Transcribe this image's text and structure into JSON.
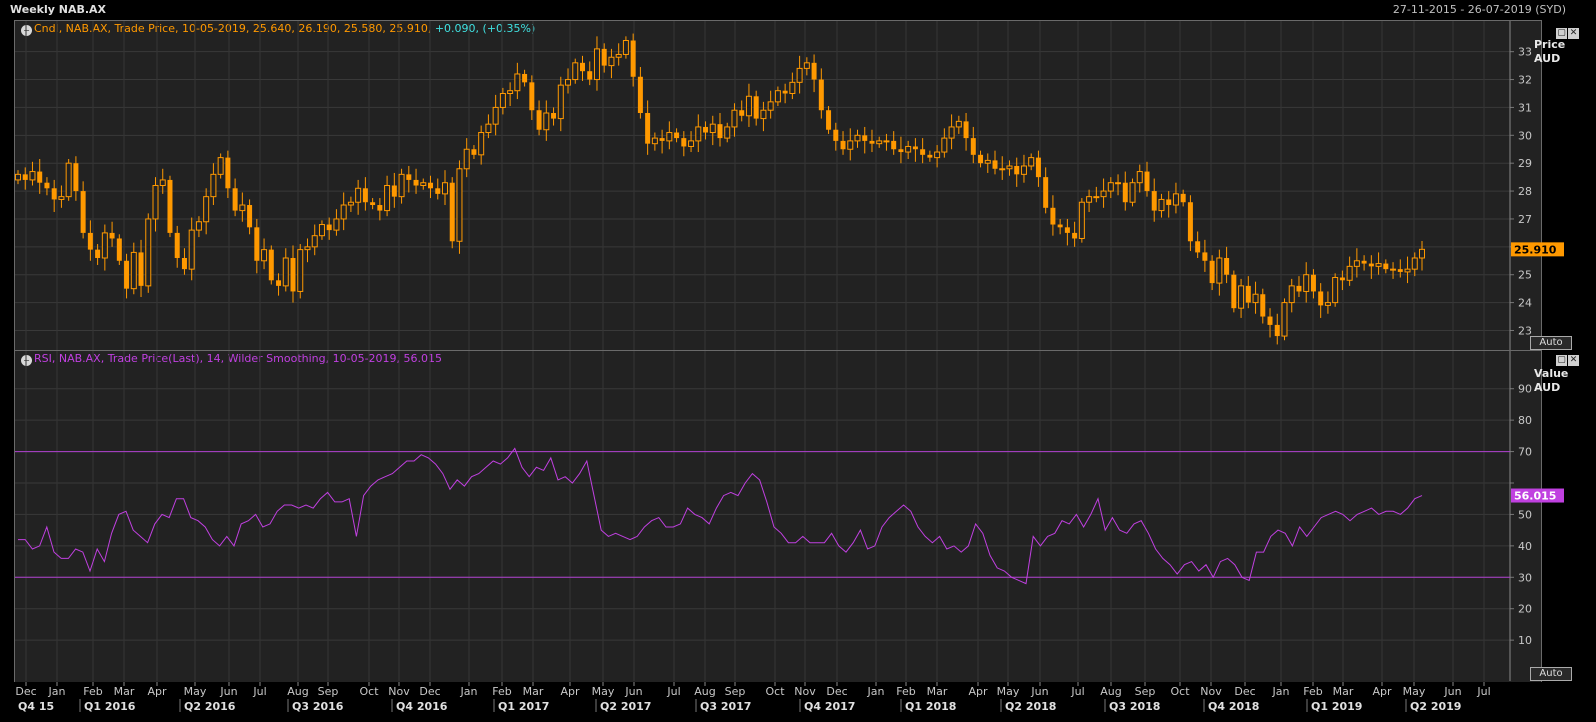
{
  "header": {
    "title": "Weekly NAB.AX",
    "date_range": "27-11-2015 - 26-07-2019 (SYD)"
  },
  "price_panel": {
    "legend_label": "Cndl, NAB.AX, Trade Price, 10-05-2019, 25.640, 26.190, 25.580, 25.910, ",
    "legend_change": "+0.090, (+0.35%)",
    "axis_title": "Price",
    "axis_unit": "AUD",
    "last_value": "25.910",
    "auto_label": "Auto"
  },
  "rsi_panel": {
    "legend_label": "RSI, NAB.AX, Trade Price(Last),  14, Wilder Smoothing,  10-05-2019, 56.015",
    "axis_title": "Value",
    "axis_unit": "AUD",
    "last_value": "56.015",
    "auto_label": "Auto"
  },
  "window_buttons": {
    "restore": "▢",
    "close": "✕"
  },
  "colors": {
    "up": "#ff9900",
    "down": "#ff9900",
    "rsi": "#c040e0",
    "band": "#b040d0",
    "price_badge": "#ff9900",
    "rsi_badge": "#c040e0",
    "change": "#40e0e0"
  },
  "chart_data": [
    {
      "type": "candlestick",
      "title": "Weekly NAB.AX",
      "ylabel": "Price AUD",
      "ylim": [
        22.3,
        34.1
      ],
      "yticks": [
        23,
        24,
        25,
        26,
        27,
        28,
        29,
        30,
        31,
        32,
        33
      ],
      "ytick_labels": [
        "23",
        "24",
        "25",
        "27",
        "28",
        "29",
        "30",
        "31",
        "32",
        "33"
      ],
      "ytick_label_values": [
        23,
        24,
        25,
        27,
        28,
        29,
        30,
        31,
        32,
        33
      ],
      "last_value": 25.91,
      "x_months": [
        "Dec",
        "Jan",
        "Feb",
        "Mar",
        "Apr",
        "May",
        "Jun",
        "Jul",
        "Aug",
        "Sep",
        "Oct",
        "Nov",
        "Dec",
        "Jan",
        "Feb",
        "Mar",
        "Apr",
        "May",
        "Jun",
        "Jul",
        "Aug",
        "Sep",
        "Oct",
        "Nov",
        "Dec",
        "Jan",
        "Feb",
        "Mar",
        "Apr",
        "May",
        "Jun",
        "Jul",
        "Aug",
        "Sep",
        "Oct",
        "Nov",
        "Dec",
        "Jan",
        "Feb",
        "Mar",
        "Apr",
        "May",
        "Jun",
        "Jul"
      ],
      "x_quarters": [
        "Q4 15",
        "Q1 2016",
        "Q2 2016",
        "Q3 2016",
        "Q4 2016",
        "Q1 2017",
        "Q2 2017",
        "Q3 2017",
        "Q4 2017",
        "Q1 2018",
        "Q2 2018",
        "Q3 2018",
        "Q4 2018",
        "Q1 2019",
        "Q2 2019"
      ],
      "closes": [
        28.6,
        28.4,
        28.7,
        28.3,
        28.1,
        27.7,
        27.8,
        29.0,
        28.0,
        26.5,
        25.9,
        25.6,
        26.5,
        26.3,
        25.5,
        24.5,
        25.8,
        24.6,
        27.0,
        28.2,
        28.4,
        26.5,
        25.6,
        25.2,
        26.6,
        26.9,
        27.8,
        28.6,
        29.2,
        28.1,
        27.3,
        27.5,
        26.7,
        25.5,
        25.9,
        24.8,
        24.6,
        25.6,
        24.4,
        25.9,
        26.0,
        26.4,
        26.8,
        26.6,
        27.0,
        27.5,
        27.6,
        28.1,
        27.6,
        27.5,
        27.3,
        28.2,
        27.8,
        28.6,
        28.4,
        28.2,
        28.3,
        28.1,
        27.9,
        28.3,
        26.2,
        28.8,
        29.5,
        29.3,
        30.1,
        30.4,
        31.0,
        31.5,
        31.6,
        32.2,
        31.9,
        30.9,
        30.2,
        30.8,
        30.6,
        31.8,
        32.0,
        32.6,
        32.3,
        32.0,
        33.1,
        32.5,
        32.8,
        32.9,
        33.4,
        32.1,
        30.8,
        29.7,
        29.9,
        29.8,
        30.1,
        29.9,
        29.6,
        29.8,
        30.3,
        30.1,
        30.4,
        29.9,
        30.3,
        30.9,
        30.7,
        31.4,
        30.6,
        30.9,
        31.2,
        31.6,
        31.5,
        31.9,
        32.4,
        32.6,
        32.0,
        30.9,
        30.2,
        29.8,
        29.5,
        29.8,
        30.0,
        29.8,
        29.7,
        29.8,
        29.8,
        29.5,
        29.4,
        29.6,
        29.5,
        29.3,
        29.2,
        29.4,
        29.9,
        30.3,
        30.5,
        29.9,
        29.3,
        29.0,
        29.1,
        28.8,
        28.8,
        28.9,
        28.6,
        28.9,
        29.2,
        28.5,
        27.4,
        26.8,
        26.7,
        26.5,
        26.3,
        27.6,
        27.8,
        27.8,
        28.0,
        28.3,
        28.3,
        27.6,
        28.3,
        28.7,
        28.0,
        27.3,
        27.7,
        27.5,
        27.9,
        27.6,
        26.2,
        25.8,
        25.5,
        24.7,
        25.6,
        25.0,
        23.8,
        24.6,
        24.0,
        24.3,
        23.5,
        23.2,
        22.8,
        24.0,
        24.6,
        24.4,
        25.0,
        24.4,
        23.9,
        24.0,
        24.9,
        24.8,
        25.3,
        25.5,
        25.4,
        25.3,
        25.4,
        25.2,
        25.2,
        25.1,
        25.2,
        25.6,
        25.91
      ]
    },
    {
      "type": "line",
      "title": "RSI, NAB.AX, Trade Price(Last), 14, Wilder Smoothing",
      "ylabel": "Value AUD",
      "ylim": [
        -3,
        102
      ],
      "yticks": [
        10,
        20,
        30,
        40,
        50,
        60,
        70,
        80,
        90
      ],
      "ytick_labels": [
        "10",
        "20",
        "30",
        "40",
        "50",
        "70",
        "80",
        "90"
      ],
      "ytick_label_values": [
        10,
        20,
        30,
        40,
        50,
        70,
        80,
        90
      ],
      "bands": [
        30,
        70
      ],
      "last_value": 56.015,
      "series": [
        {
          "values": [
            42,
            42,
            39,
            40,
            46,
            38,
            36,
            36,
            39,
            38,
            32,
            39,
            35,
            44,
            50,
            51,
            45,
            43,
            41,
            47,
            50,
            49,
            55,
            55,
            49,
            48,
            46,
            42,
            40,
            43,
            40,
            47,
            48,
            50,
            46,
            47,
            51,
            53,
            53,
            52,
            53,
            52,
            55,
            57,
            54,
            54,
            55,
            43,
            56,
            59,
            61,
            62,
            63,
            65,
            67,
            67,
            69,
            68,
            66,
            63,
            58,
            61,
            59,
            62,
            63,
            65,
            67,
            66,
            68,
            71,
            65,
            62,
            65,
            64,
            68,
            61,
            62,
            60,
            63,
            67,
            56,
            45,
            43,
            44,
            43,
            42,
            43,
            46,
            48,
            49,
            46,
            46,
            47,
            52,
            50,
            49,
            47,
            52,
            56,
            57,
            56,
            60,
            63,
            61,
            54,
            46,
            44,
            41,
            41,
            43,
            41,
            41,
            41,
            44,
            40,
            38,
            41,
            45,
            39,
            40,
            46,
            49,
            51,
            53,
            51,
            46,
            43,
            41,
            43,
            39,
            40,
            38,
            40,
            47,
            44,
            37,
            33,
            32,
            30,
            29,
            28,
            43,
            40,
            43,
            44,
            48,
            47,
            50,
            46,
            50,
            55,
            45,
            49,
            45,
            44,
            47,
            48,
            44,
            39,
            36,
            34,
            31,
            34,
            35,
            32,
            34,
            30,
            35,
            36,
            34,
            30,
            29,
            38,
            38,
            43,
            45,
            44,
            40,
            46,
            43,
            46,
            49,
            50,
            51,
            50,
            48,
            50,
            51,
            52,
            50,
            51,
            51,
            50,
            52,
            55,
            56
          ]
        }
      ]
    }
  ]
}
